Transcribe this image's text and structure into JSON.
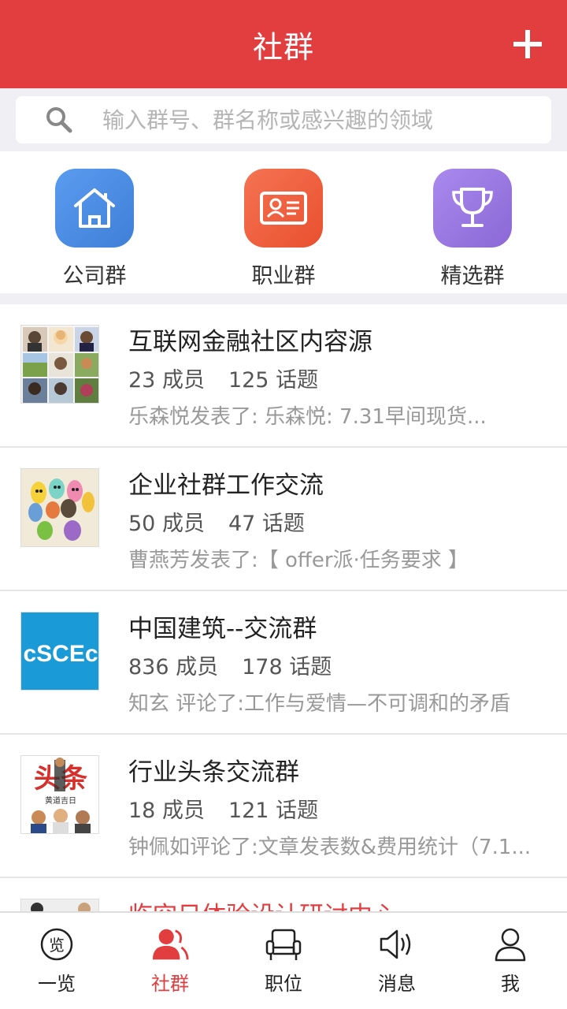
{
  "header": {
    "title": "社群"
  },
  "search": {
    "placeholder": "输入群号、群名称或感兴趣的领域"
  },
  "categories": [
    {
      "label": "公司群",
      "icon": "house-icon",
      "color": "#4a8ce6"
    },
    {
      "label": "职业群",
      "icon": "id-card-icon",
      "color": "#f0603f"
    },
    {
      "label": "精选群",
      "icon": "trophy-icon",
      "color": "#9a78e0"
    }
  ],
  "groups": [
    {
      "name": "互联网金融社区内容源",
      "members": "23 成员",
      "topics": "125 话题",
      "last": "乐森悦发表了:   乐森悦:     7.31早间现货..."
    },
    {
      "name": "企业社群工作交流",
      "members": "50 成员",
      "topics": "47 话题",
      "last": "曹燕芳发表了:【 offer派·任务要求 】"
    },
    {
      "name": "中国建筑--交流群",
      "members": "836 成员",
      "topics": "178 话题",
      "last": "知玄 评论了:工作与爱情—不可调和的矛盾"
    },
    {
      "name": "行业头条交流群",
      "members": "18 成员",
      "topics": "121 话题",
      "last": "钟佩如评论了:文章发表数&费用统计（7.1..."
    },
    {
      "name": "临空日体验设计研讨中心",
      "members": "",
      "topics": "",
      "last": ""
    }
  ],
  "avatar_text": {
    "cscec": "cSCEc",
    "toutiao": "头条",
    "toutiao_sub": "黄道吉日"
  },
  "tabs": [
    {
      "label": "一览",
      "icon": "overview-icon",
      "glyph": "览"
    },
    {
      "label": "社群",
      "icon": "community-icon"
    },
    {
      "label": "职位",
      "icon": "armchair-icon"
    },
    {
      "label": "消息",
      "icon": "speaker-icon"
    },
    {
      "label": "我",
      "icon": "person-icon"
    }
  ],
  "colors": {
    "brand": "#e23e3f",
    "background": "#efeff4"
  }
}
